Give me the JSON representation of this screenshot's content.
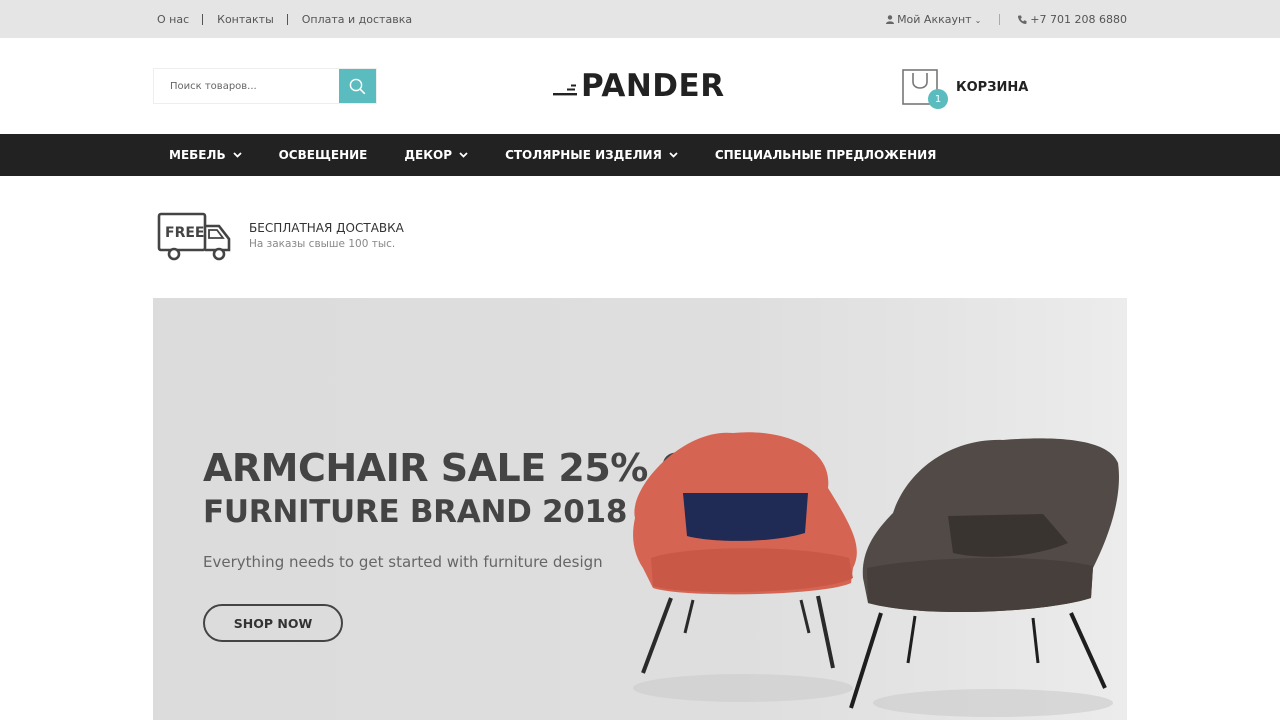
{
  "topbar": {
    "links": [
      "О нас",
      "Контакты",
      "Оплата и доставка"
    ],
    "account": "Мой Аккаунт",
    "phone": "+7 701 208 6880"
  },
  "header": {
    "search_placeholder": "Поиск товаров...",
    "logo": "PANDER",
    "cart_label": "КОРЗИНА",
    "cart_count": "1"
  },
  "nav": {
    "items": [
      {
        "label": "МЕБЕЛЬ",
        "has_dropdown": true
      },
      {
        "label": "ОСВЕЩЕНИЕ",
        "has_dropdown": false
      },
      {
        "label": "ДЕКОР",
        "has_dropdown": true
      },
      {
        "label": "СТОЛЯРНЫЕ ИЗДЕЛИЯ",
        "has_dropdown": true
      },
      {
        "label": "СПЕЦИАЛЬНЫЕ ПРЕДЛОЖЕНИЯ",
        "has_dropdown": false
      }
    ]
  },
  "shipping": {
    "badge": "FREE",
    "title": "БЕСПЛАТНАЯ ДОСТАВКА",
    "subtitle": "На заказы свыше 100 тыс."
  },
  "hero": {
    "headline": "ARMCHAIR SALE 25% OFF",
    "subheadline": "FURNITURE BRAND 2018",
    "text": "Everything needs to get started with furniture design",
    "button": "SHOP NOW"
  },
  "colors": {
    "accent": "#5bbcbf",
    "nav_bg": "#222222",
    "topbar_bg": "#e5e5e5",
    "hero_bg": "#dedede"
  }
}
